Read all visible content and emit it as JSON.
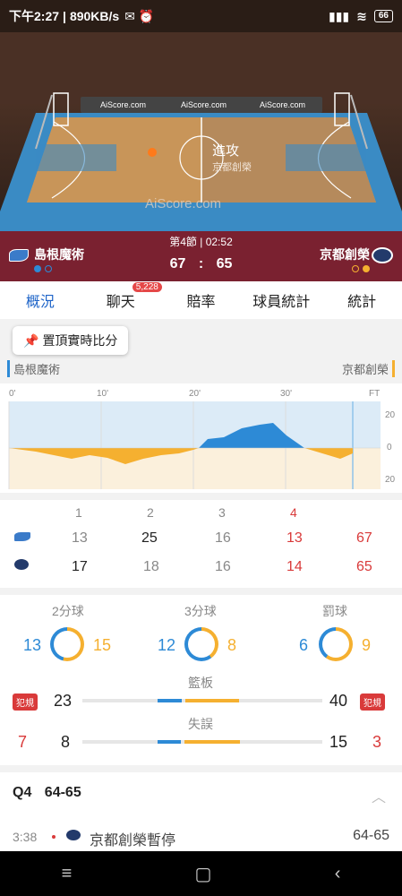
{
  "status": {
    "time": "下午2:27",
    "speed": "890KB/s",
    "battery": "66"
  },
  "court": {
    "banner": "AiScore.com",
    "watermark": "AiScore.com",
    "possession_title": "進攻",
    "possession_team": "京都創榮"
  },
  "match": {
    "period": "第4節 | 02:52",
    "home_team": "島根魔術",
    "away_team": "京都創榮",
    "home_score": "67",
    "away_score": "65",
    "sep": ":"
  },
  "tabs": [
    {
      "label": "概況"
    },
    {
      "label": "聊天",
      "badge": "5,228"
    },
    {
      "label": "賠率"
    },
    {
      "label": "球員統計"
    },
    {
      "label": "統計"
    }
  ],
  "pin": {
    "label": "置頂實時比分"
  },
  "teams": {
    "home": "島根魔術",
    "away": "京都創榮"
  },
  "momentum": {
    "ticks": [
      "0'",
      "10'",
      "20'",
      "30'",
      "FT"
    ],
    "y_labels": [
      "20",
      "0",
      "20"
    ]
  },
  "quarters": {
    "headers": [
      "1",
      "2",
      "3",
      "4"
    ],
    "home": [
      "13",
      "25",
      "16",
      "13",
      "67"
    ],
    "away": [
      "17",
      "18",
      "16",
      "14",
      "65"
    ]
  },
  "stats": {
    "two_pt": {
      "label": "2分球",
      "home": "13",
      "away": "15"
    },
    "three_pt": {
      "label": "3分球",
      "home": "12",
      "away": "8"
    },
    "free_throw": {
      "label": "罰球",
      "home": "6",
      "away": "9"
    },
    "rebounds": {
      "label": "籃板",
      "home": "23",
      "away": "40",
      "home_fraction": 0.365,
      "away_fraction": 0.635
    },
    "turnovers": {
      "label": "失誤",
      "home": "8",
      "away": "15",
      "home_fraction": 0.35,
      "away_fraction": 0.65
    },
    "foul_label": "犯規",
    "home_fouls": "7",
    "away_fouls": "3"
  },
  "events": {
    "quarter": "Q4",
    "quarter_score": "64-65",
    "item": {
      "time": "3:38",
      "text": "京都創榮暫停",
      "score": "64-65"
    }
  },
  "colors": {
    "home": "#2d8ad6",
    "away": "#f5b030",
    "accent": "#1e64c8",
    "scorebar": "#7a2130"
  }
}
